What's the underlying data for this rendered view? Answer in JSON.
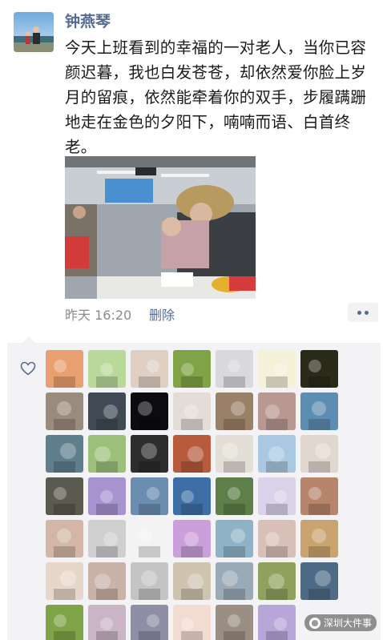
{
  "post": {
    "author": "钟燕琴",
    "text": "今天上班看到的幸福的一对老人，当你已容颜迟暮，我也白发苍苍，却依然爱你脸上岁月的留痕，依然能牵着你的双手，步履蹒跚地走在金色的夕阳下，喃喃而语、白首终老。",
    "timestamp": "昨天 16:20",
    "delete_label": "删除",
    "more_icon": "more-dots-icon",
    "photo_icon": "photo-elderly-couple"
  },
  "likes": {
    "heart_icon": "heart-outline-icon",
    "rows": [
      [
        {
          "name": "liker-1",
          "fill": "#e8a070"
        },
        {
          "name": "liker-2",
          "fill": "#b9d99a"
        },
        {
          "name": "liker-3",
          "fill": "#e0d0c4"
        },
        {
          "name": "liker-4",
          "fill": "#7fa345"
        },
        {
          "name": "liker-5",
          "fill": "#d9d9dc"
        },
        {
          "name": "liker-6",
          "fill": "#f5f0d8"
        },
        {
          "name": "liker-7",
          "fill": "#2b2b1a"
        }
      ],
      [
        {
          "name": "liker-8",
          "fill": "#9a8c7c"
        },
        {
          "name": "liker-9",
          "fill": "#404a55"
        },
        {
          "name": "liker-10",
          "fill": "#0c0c10"
        },
        {
          "name": "liker-11",
          "fill": "#e4dcd6"
        },
        {
          "name": "liker-12",
          "fill": "#9b8068"
        },
        {
          "name": "liker-13",
          "fill": "#b89890"
        },
        {
          "name": "liker-14",
          "fill": "#5d8db0"
        }
      ],
      [
        {
          "name": "liker-15",
          "fill": "#5f7f8c"
        },
        {
          "name": "liker-16",
          "fill": "#9cc07a"
        },
        {
          "name": "liker-17",
          "fill": "#2d2d2d"
        },
        {
          "name": "liker-18",
          "fill": "#b85a3c"
        },
        {
          "name": "liker-19",
          "fill": "#e4dfd6"
        },
        {
          "name": "liker-20",
          "fill": "#a9c9e3"
        },
        {
          "name": "liker-21",
          "fill": "#e2d7cf"
        }
      ],
      [
        {
          "name": "liker-22",
          "fill": "#5a5a4e"
        },
        {
          "name": "liker-23",
          "fill": "#a693cf"
        },
        {
          "name": "liker-24",
          "fill": "#6a8db0"
        },
        {
          "name": "liker-25",
          "fill": "#3d6fa6"
        },
        {
          "name": "liker-26",
          "fill": "#5e7f4a"
        },
        {
          "name": "liker-27",
          "fill": "#dad2e8"
        },
        {
          "name": "liker-28",
          "fill": "#b7856c"
        }
      ],
      [
        {
          "name": "liker-29",
          "fill": "#d3b6a6"
        },
        {
          "name": "liker-30",
          "fill": "#cfcfd0"
        },
        {
          "name": "liker-31",
          "fill": "#f3f3f3"
        },
        {
          "name": "liker-32",
          "fill": "#c9a0da"
        },
        {
          "name": "liker-33",
          "fill": "#8fb3c6"
        },
        {
          "name": "liker-34",
          "fill": "#d8c0b8"
        },
        {
          "name": "liker-35",
          "fill": "#c9a46e"
        }
      ],
      [
        {
          "name": "liker-36",
          "fill": "#e7d6ca"
        },
        {
          "name": "liker-37",
          "fill": "#c9b2a8"
        },
        {
          "name": "liker-38",
          "fill": "#c4c4c4"
        },
        {
          "name": "liker-39",
          "fill": "#cfc4b0"
        },
        {
          "name": "liker-40",
          "fill": "#9aaab6"
        },
        {
          "name": "liker-41",
          "fill": "#8ea25e"
        },
        {
          "name": "liker-42",
          "fill": "#4d6b86"
        }
      ],
      [
        {
          "name": "liker-43",
          "fill": "#7fa347"
        },
        {
          "name": "liker-44",
          "fill": "#c9b5c6"
        },
        {
          "name": "liker-45",
          "fill": "#8e8ea6"
        },
        {
          "name": "liker-46",
          "fill": "#f2dcd2"
        },
        {
          "name": "liker-47",
          "fill": "#9b8f84"
        },
        {
          "name": "liker-48",
          "fill": "#b6a7d8"
        }
      ]
    ]
  },
  "watermark": {
    "text": "深圳大件事"
  }
}
